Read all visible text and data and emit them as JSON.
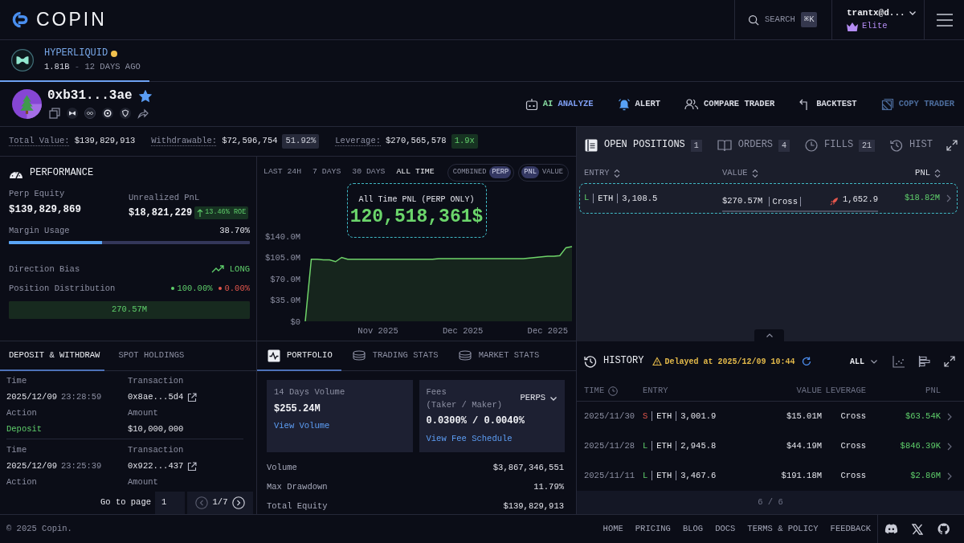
{
  "topbar": {
    "brand": "COPIN",
    "search": {
      "label": "SEARCH",
      "shortcut": "⌘K"
    },
    "account": {
      "name": "trantx@d...",
      "plan": "Elite"
    }
  },
  "protocol_tabs": [
    {
      "name": "HYPERLIQUID",
      "color": "#f2c14e",
      "volume": "1.81B",
      "separator": "-",
      "age": "12 DAYS AGO",
      "selected": true
    }
  ],
  "trader": {
    "address": "0xb31...3ae",
    "favorite": true
  },
  "actions": [
    {
      "kind": "ai",
      "accent": "AI",
      "label": "ANALYZE"
    },
    {
      "kind": "alert",
      "label": "ALERT"
    },
    {
      "kind": "compare",
      "label": "COMPARE TRADER"
    },
    {
      "kind": "backtest",
      "label": "BACKTEST"
    },
    {
      "kind": "copy",
      "label": "COPY TRADER"
    }
  ],
  "summary": [
    {
      "label": "Total Value:",
      "value": "$139,829,913"
    },
    {
      "kind": "neutral",
      "label": "Withdrawable:",
      "value": "$72,596,754",
      "badge": "51.92%"
    },
    {
      "kind": "positive",
      "label": "Leverage:",
      "value": "$270,565,578",
      "badge": "1.9x"
    }
  ],
  "performance": {
    "title": "PERFORMANCE",
    "perp_equity": {
      "label": "Perp Equity",
      "value": "$139,829,869"
    },
    "unrealized_pnl": {
      "label": "Unrealized PnL",
      "value": "$18,821,229",
      "roe": "13.46% ROE"
    },
    "margin_usage": {
      "label": "Margin Usage",
      "value": "38.70%",
      "level": 0.387
    },
    "direction_bias": {
      "label": "Direction Bias",
      "value": "LONG",
      "kind": "long"
    },
    "position_distribution": {
      "label": "Position Distribution",
      "long": "100.00%",
      "short": "0.00%",
      "level": 1,
      "size": "270.57M"
    }
  },
  "chart": {
    "ranges": [
      {
        "label": "LAST 24H",
        "selected": false
      },
      {
        "label": "7 DAYS",
        "selected": false
      },
      {
        "label": "30 DAYS",
        "selected": false
      },
      {
        "label": "ALL TIME",
        "selected": true
      }
    ],
    "sources": [
      {
        "label": "COMBINED",
        "selected": false
      },
      {
        "label": "PERP",
        "selected": true
      }
    ],
    "metrics": [
      {
        "label": "PNL",
        "selected": true
      },
      {
        "label": "VALUE",
        "selected": false
      }
    ],
    "callout": {
      "label": "All Time PNL (PERP ONLY)",
      "value": "120,518,361$"
    },
    "chart_data": {
      "type": "area",
      "categories": [
        null,
        null,
        null,
        null,
        null,
        null,
        null,
        null,
        null,
        null,
        null,
        null,
        "Nov 2025",
        null,
        null,
        null,
        null,
        null,
        null,
        null,
        null,
        null,
        null,
        null,
        null,
        null,
        "Dec 2025",
        null,
        null,
        null,
        null,
        null,
        null,
        null,
        null,
        null,
        null,
        null,
        null,
        null,
        "Dec 2025",
        null,
        null,
        null,
        null
      ],
      "values": [
        0,
        102,
        102,
        101,
        101,
        98,
        105,
        102,
        102,
        102,
        102,
        102,
        102,
        102,
        102,
        102,
        102,
        102,
        102,
        102,
        102,
        102,
        103,
        103,
        103,
        103,
        103,
        103,
        103,
        103,
        103,
        103,
        103,
        103,
        103,
        103,
        103,
        104,
        105,
        106,
        107,
        107,
        108,
        121,
        123
      ],
      "ylim": [
        0,
        140
      ],
      "yticks": [
        {
          "value": 0,
          "label": "$0"
        },
        {
          "value": 35,
          "label": "$35.0M"
        },
        {
          "value": 70,
          "label": "$70.0M"
        },
        {
          "value": 105,
          "label": "$105.0M"
        },
        {
          "value": 140,
          "label": "$140.0M"
        }
      ]
    }
  },
  "positions": {
    "tabs": [
      {
        "kind": "positions",
        "label": "OPEN POSITIONS",
        "count": "1",
        "selected": true
      },
      {
        "kind": "orders",
        "label": "ORDERS",
        "count": "4",
        "selected": false
      },
      {
        "kind": "fills",
        "label": "FILLS",
        "count": "21",
        "selected": false
      },
      {
        "kind": "history",
        "label": "HIST",
        "selected": false
      }
    ],
    "columns": [
      "ENTRY",
      "VALUE",
      "PNL"
    ],
    "rows": [
      {
        "kind": "long",
        "side": "L",
        "symbol": "ETH",
        "entry_price": "3,108.5",
        "value": "$270.57M",
        "margin_mode": "Cross",
        "liquidation_price": "1,652.9",
        "pnl": "$18.82M",
        "highlighted": true
      }
    ]
  },
  "transfers": {
    "tabs": [
      {
        "label": "DEPOSIT & WITHDRAW",
        "selected": true
      },
      {
        "label": "SPOT HOLDINGS",
        "selected": false
      }
    ],
    "records": [
      {
        "time_label": "Time",
        "date": "2025/12/09",
        "time": "23:28:59",
        "tx_label": "Transaction",
        "tx": "0x8ae...5d4",
        "action_label": "Action",
        "action": "Deposit",
        "amount_label": "Amount",
        "amount": "$10,000,000"
      },
      {
        "time_label": "Time",
        "date": "2025/12/09",
        "time": "23:25:39",
        "tx_label": "Transaction",
        "tx": "0x922...437",
        "action_label": "Action",
        "amount_label": "Amount"
      }
    ],
    "pagination": {
      "label": "Go to page",
      "page": "1",
      "pages": "1/7"
    }
  },
  "portfolio": {
    "tabs": [
      {
        "kind": "portfolio",
        "label": "PORTFOLIO",
        "selected": true
      },
      {
        "kind": "trading",
        "label": "TRADING STATS",
        "selected": false
      },
      {
        "kind": "market",
        "label": "MARKET STATS",
        "selected": false
      }
    ],
    "volume_card": {
      "label": "14 Days Volume",
      "value": "$255.24M",
      "link": "View Volume"
    },
    "fees_card": {
      "label": "Fees",
      "sublabel": "(Taker / Maker)",
      "market": "PERPS",
      "value": "0.0300% / 0.0040%",
      "link": "View Fee Schedule"
    },
    "stats": [
      {
        "label": "Volume",
        "value": "$3,867,346,551"
      },
      {
        "label": "Max Drawdown",
        "value": "11.79%"
      },
      {
        "label": "Total Equity",
        "value": "$139,829,913"
      }
    ]
  },
  "history": {
    "title": "HISTORY",
    "notice": "Delayed at 2025/12/09 10:44",
    "filter": "ALL",
    "columns": [
      "TIME",
      "ENTRY",
      "VALUE",
      "LEVERAGE",
      "PNL"
    ],
    "rows": [
      {
        "kind": "short",
        "time": "2025/11/30",
        "side": "S",
        "symbol": "ETH",
        "entry_price": "3,001.9",
        "value": "$15.01M",
        "leverage": "Cross",
        "pnl": "$63.54K"
      },
      {
        "kind": "long",
        "time": "2025/11/28",
        "side": "L",
        "symbol": "ETH",
        "entry_price": "2,945.8",
        "value": "$44.19M",
        "leverage": "Cross",
        "pnl": "$846.39K"
      },
      {
        "kind": "long",
        "time": "2025/11/11",
        "side": "L",
        "symbol": "ETH",
        "entry_price": "3,467.6",
        "value": "$191.18M",
        "leverage": "Cross",
        "pnl": "$2.86M"
      }
    ],
    "page_info": "6 / 6"
  },
  "footer": {
    "copyright": "© 2025 Copin.",
    "links": [
      "HOME",
      "PRICING",
      "BLOG",
      "DOCS",
      "TERMS & POLICY",
      "FEEDBACK"
    ]
  }
}
